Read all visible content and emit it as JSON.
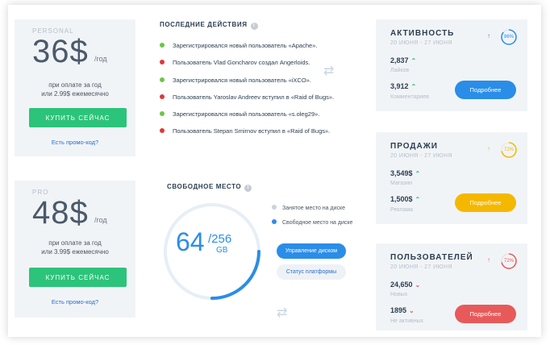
{
  "plans": [
    {
      "name": "PERSONAL",
      "price": "36$",
      "period": "/год",
      "note_line1": "при оплате за год",
      "note_line2": "или 2.99$ ежемесячно",
      "buy_label": "КУПИТЬ СЕЙЧАС",
      "promo_label": "Есть промо-код?"
    },
    {
      "name": "PRO",
      "price": "48$",
      "period": "/год",
      "note_line1": "при оплате за год",
      "note_line2": "или 3.99$ ежемесячно",
      "buy_label": "КУПИТЬ СЕЙЧАС",
      "promo_label": "Есть промо-код?"
    }
  ],
  "activity": {
    "title": "ПОСЛЕДНИЕ ДЕЙСТВИЯ",
    "info_icon": "i",
    "items": [
      {
        "text": "Зарегистрировался новый пользователь «Apache».",
        "color": "#6cc644"
      },
      {
        "text": "Пользователь Vlad Goncharov создал Angerloids.",
        "color": "#e03838"
      },
      {
        "text": "Зарегистрировался новый пользователь «iXCO».",
        "color": "#6cc644"
      },
      {
        "text": "Пользователь Yaroslav Andreev вступил в «Raid of Bugs».",
        "color": "#e03838"
      },
      {
        "text": "Зарегистрировался новый пользователь «s.oleg29».",
        "color": "#6cc644"
      },
      {
        "text": "Пользователь Stepan Smirnov вступил в «Raid of Bugs».",
        "color": "#e03838"
      }
    ]
  },
  "storage": {
    "title": "СВОБОДНОЕ МЕСТО",
    "info_icon": "i",
    "used": "64",
    "total": "/256",
    "unit": "GB",
    "fraction": 0.25,
    "legend_used": "Занятое место на диске",
    "legend_free": "Свободное место на диске",
    "manage_label": "Управление диском",
    "status_label": "Статус платформы"
  },
  "stats": [
    {
      "title": "АКТИВНОСТЬ",
      "date": "20 ИЮНЯ - 27 ИЮНЯ",
      "percent": "86%",
      "percent_value": 86,
      "color": "#2a8de8",
      "v1": "2,837",
      "v1_sub": "Лайков",
      "v1_trend": "^",
      "v2": "3,912",
      "v2_sub": "Комментариев",
      "v2_trend": "^",
      "button": "Подробнее"
    },
    {
      "title": "ПРОДАЖИ",
      "date": "20 ИЮНЯ - 27 ИЮНЯ",
      "percent": "72%",
      "percent_value": 72,
      "color": "#f5b800",
      "v1": "3,549$",
      "v1_sub": "Магазин",
      "v1_trend": "^",
      "v2": "1,500$",
      "v2_sub": "Реклама",
      "v2_trend": "^",
      "button": "Подробнее"
    },
    {
      "title": "ПОЛЬЗОВАТЕЛЕЙ",
      "date": "20 ИЮНЯ - 27 ИЮНЯ",
      "percent": "72%",
      "percent_value": 72,
      "color": "#e85a5a",
      "v1": "24,650",
      "v1_sub": "Новых",
      "v1_trend": "v",
      "v2": "1895",
      "v2_sub": "Не активных",
      "v2_trend": "v",
      "button": "Подробнее"
    }
  ]
}
